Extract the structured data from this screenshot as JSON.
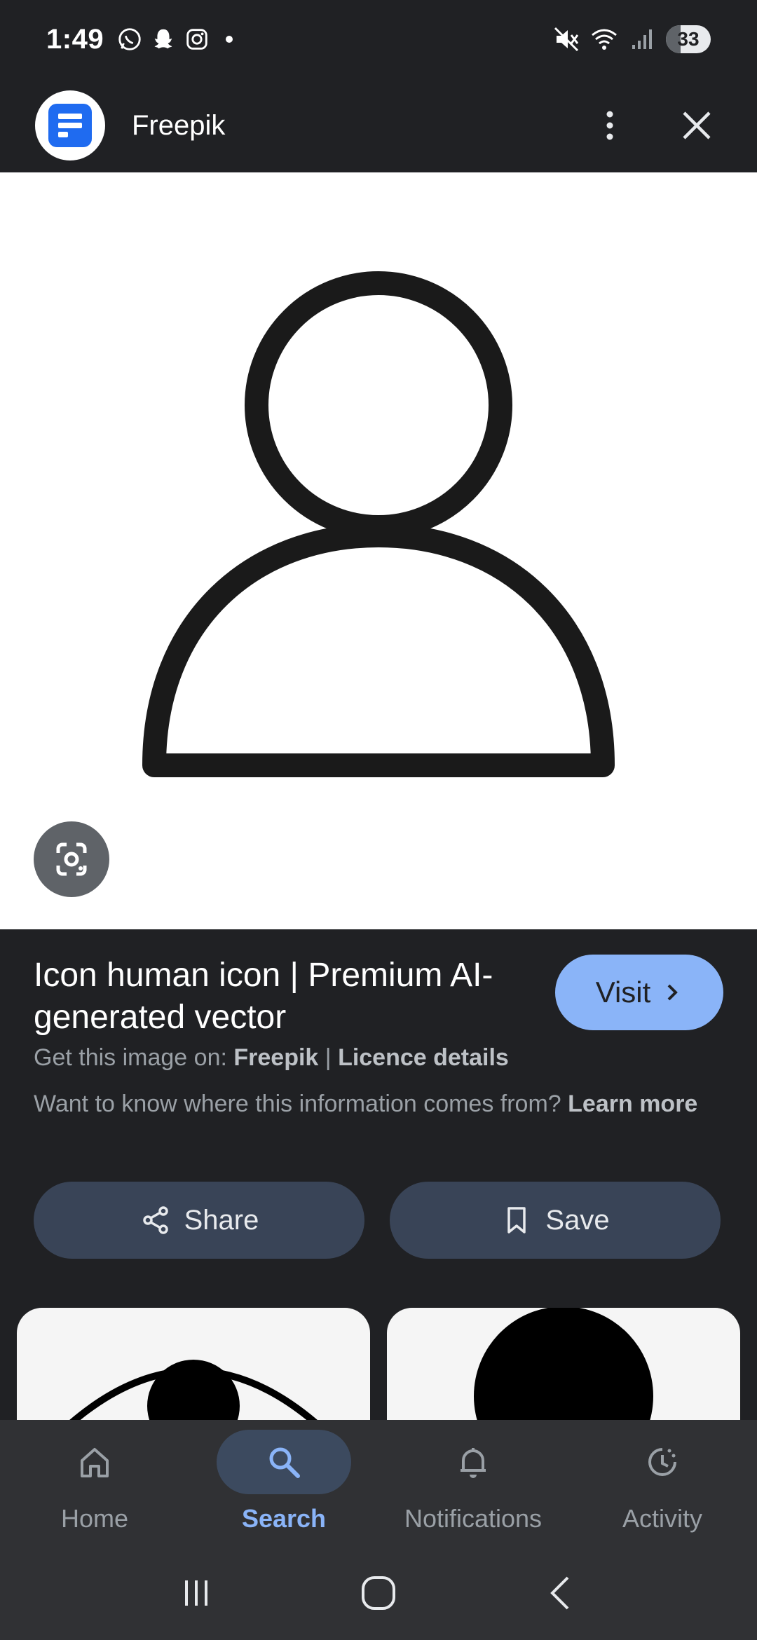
{
  "status_bar": {
    "time": "1:49",
    "battery": "33",
    "battery_fraction": 0.33,
    "left_icons": [
      "whatsapp-icon",
      "snapchat-icon",
      "instagram-icon",
      "notification-dot"
    ],
    "right_icons": [
      "mute-icon",
      "wifi-icon",
      "signal-icon",
      "battery-icon"
    ]
  },
  "header": {
    "site_name": "Freepik",
    "logo_color": "#1f6bf0"
  },
  "image": {
    "subject": "person-outline"
  },
  "info": {
    "title": "Icon human icon | Premium AI-generated vector",
    "visit_label": "Visit",
    "source_prefix": "Get this image on: ",
    "source_name": "Freepik",
    "separator": " | ",
    "licence": "Licence details",
    "learn_prefix": "Want to know where this information comes from? ",
    "learn_more": "Learn more"
  },
  "actions": {
    "share_label": "Share",
    "save_label": "Save"
  },
  "bottom_nav": {
    "items": [
      {
        "label": "Home",
        "icon": "home-icon",
        "active": false
      },
      {
        "label": "Search",
        "icon": "search-icon",
        "active": true
      },
      {
        "label": "Notifications",
        "icon": "bell-icon",
        "active": false
      },
      {
        "label": "Activity",
        "icon": "activity-icon",
        "active": false
      }
    ]
  },
  "colors": {
    "background": "#202124",
    "accent": "#8ab4f8",
    "action_button": "#394457",
    "nav_bg": "#303134"
  }
}
